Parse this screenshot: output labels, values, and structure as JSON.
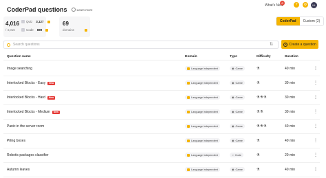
{
  "header": {
    "title": "CoderPad questions",
    "learn_more": "Learn more",
    "whats_new": "What's New",
    "notif_count": "8",
    "avatar_initials": "KL"
  },
  "stats": {
    "total": "4,016",
    "total_sub": "/ 4,016",
    "quiz_label": "Quiz",
    "quiz_count": "3,127",
    "code_label": "Code",
    "code_count": "889",
    "domains_count": "69",
    "domains_label": "domains"
  },
  "tabs": [
    {
      "label": "CoderPad",
      "active": true
    },
    {
      "label": "Custom (2)",
      "active": false
    }
  ],
  "search": {
    "placeholder": "Search questions"
  },
  "create_button": "Create a question",
  "columns": {
    "name": "Question name",
    "domain": "Domain",
    "type": "Type",
    "difficulty": "Difficulty",
    "duration": "Duration"
  },
  "new_tag": "New",
  "rows": [
    {
      "name": "Image searching",
      "new": false,
      "domain": "Language independent",
      "type": "Game",
      "difficulty": "easy",
      "duration": "40 min"
    },
    {
      "name": "Interlocked Blocks - Easy",
      "new": true,
      "domain": "Language independent",
      "type": "Game",
      "difficulty": "easy",
      "duration": "30 min"
    },
    {
      "name": "Interlocked Blocks - Hard",
      "new": true,
      "domain": "Language independent",
      "type": "Game",
      "difficulty": "hard",
      "duration": "30 min"
    },
    {
      "name": "Interlocked Blocks - Medium",
      "new": true,
      "domain": "Language independent",
      "type": "Game",
      "difficulty": "medium",
      "duration": "30 min"
    },
    {
      "name": "Panic in the server room",
      "new": false,
      "domain": "Language independent",
      "type": "Game",
      "difficulty": "hard",
      "duration": "40 min"
    },
    {
      "name": "Piling boxes",
      "new": false,
      "domain": "Language independent",
      "type": "Game",
      "difficulty": "easy",
      "duration": "40 min"
    },
    {
      "name": "Robotic packages classifier",
      "new": false,
      "domain": "Language independent",
      "type": "Code",
      "difficulty": "easy",
      "duration": "20 min"
    },
    {
      "name": "Autumn leaves",
      "new": false,
      "domain": "Language independent",
      "type": "Game",
      "difficulty": "easy",
      "duration": "40 min"
    }
  ]
}
